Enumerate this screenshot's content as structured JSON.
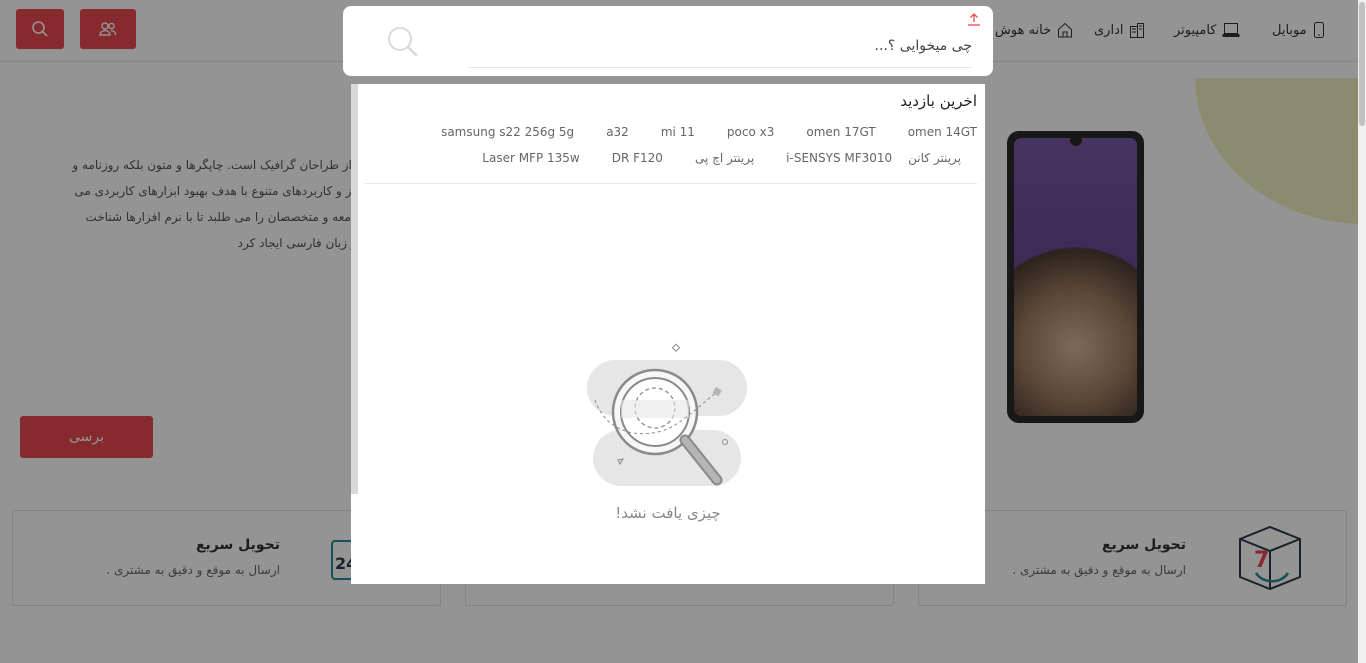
{
  "nav": {
    "items": [
      {
        "label": "موبایل",
        "icon": "mobile-icon"
      },
      {
        "label": "کامپیوتر",
        "icon": "laptop-icon"
      },
      {
        "label": "اداری",
        "icon": "building-icon"
      },
      {
        "label": "خانه هوش",
        "icon": "home-icon"
      }
    ],
    "users_icon": "users-icon",
    "search_icon": "search-icon"
  },
  "hero": {
    "lines": [
      "ه از طراحان گرافیک است. چاپگرها و متون بلکه روزنامه و",
      "نیاز و کاربردهای متنوع با هدف بهبود ابزارهای کاربردی می",
      "جامعه و متخصصان را می طلبد تا با نرم افزارها شناخت",
      "در زبان فارسی ایجاد کرد"
    ],
    "button_label": "برسی"
  },
  "features": [
    {
      "title": "تحویل سریع",
      "subtitle": "ارسال به موقع و دقیق به مشتری ."
    },
    {
      "title": "تحویل سریع",
      "subtitle": "ارسال به موقع و دقیق به مشتری ."
    }
  ],
  "search": {
    "placeholder": "چی میخوایی ؟...",
    "value": ""
  },
  "recent": {
    "title": "اخرین بازدید",
    "tags": [
      "omen 14GT",
      "omen 17GT",
      "poco x3",
      "mi 11",
      "a32",
      "samsung s22 256g 5g",
      "پرینتر کانن",
      "i-SENSYS MF3010",
      "پرینتر اچ پی",
      "DR F120",
      "Laser MFP 135w"
    ]
  },
  "empty": {
    "message": "چیزی یافت نشد!"
  },
  "colors": {
    "accent": "#e8494f",
    "overlay": "#000000"
  }
}
